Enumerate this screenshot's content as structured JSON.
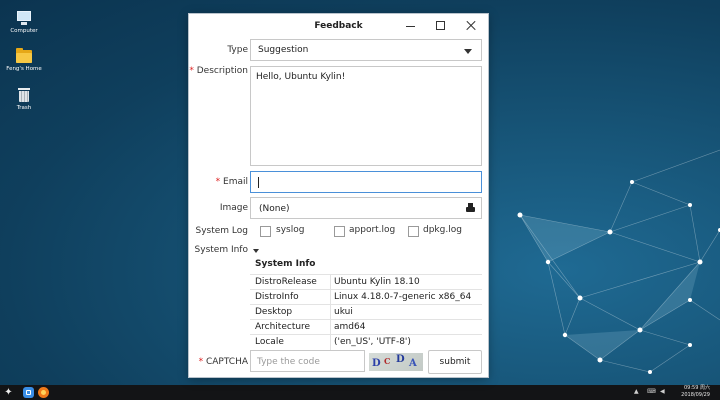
{
  "desktop": {
    "icons": [
      {
        "label": "Computer"
      },
      {
        "label": "Feng's Home"
      },
      {
        "label": "Trash"
      }
    ]
  },
  "dialog": {
    "title": "Feedback",
    "type_label": "Type",
    "type_value": "Suggestion",
    "description_label": "Description",
    "description_value": "Hello, Ubuntu Kylin!",
    "email_label": "Email",
    "email_value": "",
    "image_label": "Image",
    "image_value": "(None)",
    "system_log_label": "System Log",
    "logs": [
      {
        "label": "syslog",
        "checked": false
      },
      {
        "label": "apport.log",
        "checked": false
      },
      {
        "label": "dpkg.log",
        "checked": false
      }
    ],
    "system_info_label": "System Info",
    "system_info_header": "System Info",
    "system_info_rows": [
      {
        "key": "DistroRelease",
        "value": "Ubuntu Kylin 18.10"
      },
      {
        "key": "DistroInfo",
        "value": "Linux 4.18.0-7-generic x86_64"
      },
      {
        "key": "Desktop",
        "value": "ukui"
      },
      {
        "key": "Architecture",
        "value": "amd64"
      },
      {
        "key": "Locale",
        "value": "('en_US', 'UTF-8')"
      }
    ],
    "captcha_label": "CAPTCHA",
    "captcha_placeholder": "Type the code",
    "captcha_text": [
      "D",
      "C",
      "D",
      "A"
    ],
    "submit_label": "submit",
    "required_marker": "*"
  },
  "taskbar": {
    "time": "09:59",
    "weekday": "周六",
    "date": "2018/09/29"
  },
  "colors": {
    "accent": "#4a90d9",
    "required": "#d22222"
  }
}
